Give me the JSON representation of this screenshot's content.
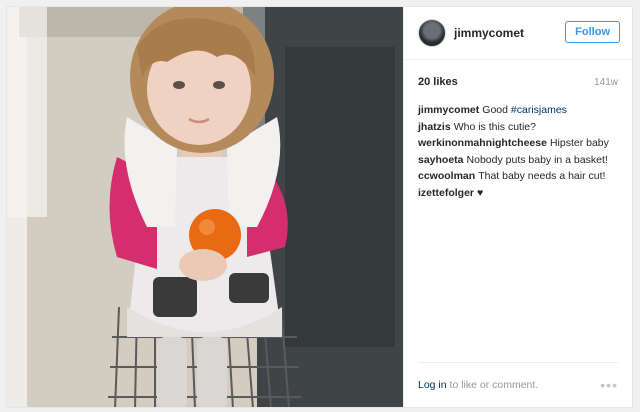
{
  "post": {
    "username": "jimmycomet",
    "follow_label": "Follow",
    "likes": "20 likes",
    "time": "141w",
    "comments": [
      {
        "user": "jimmycomet",
        "text": "Good ",
        "tag": "#carisjames"
      },
      {
        "user": "jhatzis",
        "text": "Who is this cutie?",
        "tag": ""
      },
      {
        "user": "werkinonmahnightcheese",
        "text": "Hipster baby",
        "tag": ""
      },
      {
        "user": "sayhoeta",
        "text": "Nobody puts baby in a basket!",
        "tag": ""
      },
      {
        "user": "ccwoolman",
        "text": "That baby needs a hair cut!",
        "tag": ""
      },
      {
        "user": "izettefolger",
        "text": "♥",
        "tag": ""
      }
    ],
    "login_label": "Log in",
    "login_suffix": " to like or comment.",
    "more_label": "•••"
  },
  "colors": {
    "accent": "#3897f0",
    "link": "#003569",
    "text": "#262626",
    "muted": "#999999"
  },
  "icons": {
    "more": "ellipsis-icon"
  }
}
